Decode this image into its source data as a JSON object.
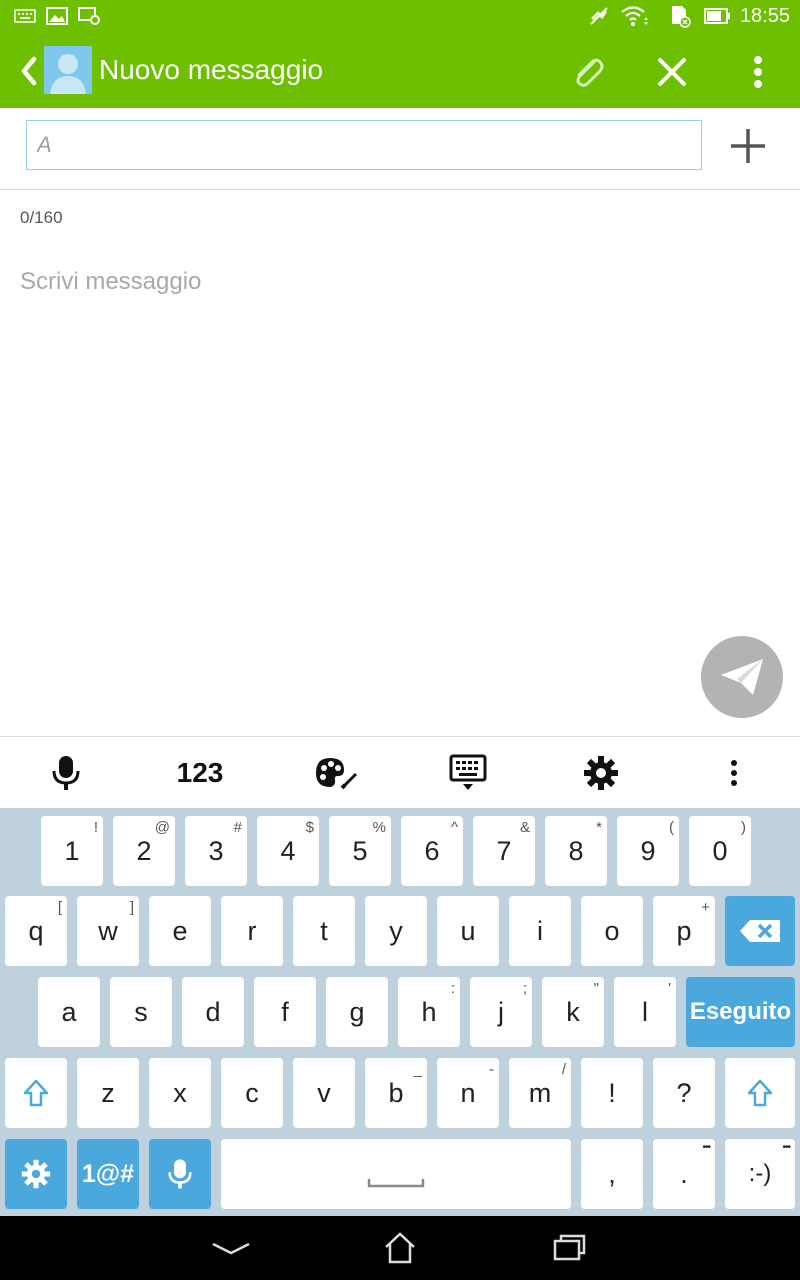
{
  "status_bar": {
    "time": "18:55",
    "icons": [
      "keyboard-icon",
      "image-icon",
      "screen-settings-icon",
      "mute-icon",
      "wifi-icon",
      "sd-card-icon",
      "battery-icon"
    ]
  },
  "app_bar": {
    "title": "Nuovo messaggio",
    "color": "#6dbf00"
  },
  "recipient": {
    "placeholder": "A"
  },
  "message": {
    "counter": "0/160",
    "placeholder": "Scrivi messaggio"
  },
  "keyboard_toolbar": {
    "numbers_label": "123"
  },
  "keyboard": {
    "row1": [
      {
        "label": "1",
        "hint": "!"
      },
      {
        "label": "2",
        "hint": "@"
      },
      {
        "label": "3",
        "hint": "#"
      },
      {
        "label": "4",
        "hint": "$"
      },
      {
        "label": "5",
        "hint": "%"
      },
      {
        "label": "6",
        "hint": "^"
      },
      {
        "label": "7",
        "hint": "&"
      },
      {
        "label": "8",
        "hint": "*"
      },
      {
        "label": "9",
        "hint": "("
      },
      {
        "label": "0",
        "hint": ")"
      }
    ],
    "row2": [
      {
        "label": "q",
        "hint": "["
      },
      {
        "label": "w",
        "hint": "]"
      },
      {
        "label": "e",
        "hint": ""
      },
      {
        "label": "r",
        "hint": ""
      },
      {
        "label": "t",
        "hint": ""
      },
      {
        "label": "y",
        "hint": ""
      },
      {
        "label": "u",
        "hint": ""
      },
      {
        "label": "i",
        "hint": ""
      },
      {
        "label": "o",
        "hint": ""
      },
      {
        "label": "p",
        "hint": "+"
      }
    ],
    "row3": [
      {
        "label": "a",
        "hint": ""
      },
      {
        "label": "s",
        "hint": ""
      },
      {
        "label": "d",
        "hint": ""
      },
      {
        "label": "f",
        "hint": ""
      },
      {
        "label": "g",
        "hint": ""
      },
      {
        "label": "h",
        "hint": ":"
      },
      {
        "label": "j",
        "hint": ";"
      },
      {
        "label": "k",
        "hint": "\""
      },
      {
        "label": "l",
        "hint": "'"
      }
    ],
    "row4": [
      {
        "label": "z",
        "hint": ""
      },
      {
        "label": "x",
        "hint": ""
      },
      {
        "label": "c",
        "hint": ""
      },
      {
        "label": "v",
        "hint": ""
      },
      {
        "label": "b",
        "hint": "_"
      },
      {
        "label": "n",
        "hint": "-"
      },
      {
        "label": "m",
        "hint": "/"
      },
      {
        "label": "!",
        "hint": ""
      },
      {
        "label": "?",
        "hint": ""
      }
    ],
    "done_label": "Eseguito",
    "symbols_label": "1@#",
    "comma_label": ",",
    "period_label": ".",
    "period_hint": "•••",
    "smiley_label": ":-)",
    "smiley_hint": "•••",
    "accent_color": "#4aa8dc",
    "background_color": "#bfd1dc"
  }
}
